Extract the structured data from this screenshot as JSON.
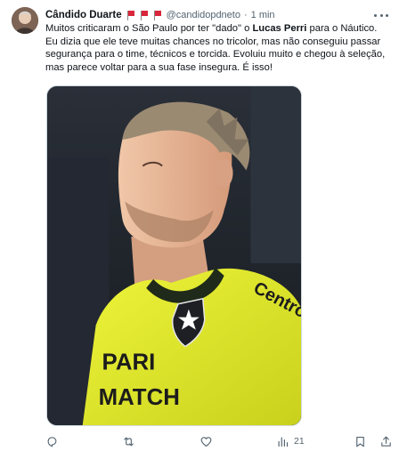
{
  "author": {
    "name": "Cândido Duarte",
    "handle": "@candidopdneto",
    "separator": "·",
    "time": "1 min",
    "flags": [
      "red-flag",
      "red-flag",
      "red-flag"
    ]
  },
  "tweet": {
    "text_segments": [
      "Muitos criticaram o São Paulo por ter \"dado\" o ",
      "Lucas Perri",
      " para o Náutico. Eu dizia que ele teve muitas chances no tricolor,  mas não conseguiu passar segurança para o time, técnicos e torcida. Evoluiu muito e chegou à seleção, mas parece voltar para a sua fase insegura. É isso!"
    ]
  },
  "media": {
    "jersey_text_1": "Centro",
    "jersey_text_2": "PARI",
    "jersey_text_3": "MATCH",
    "jersey_color": "#e6ef2a",
    "background_color": "#1b1f26"
  },
  "actions": {
    "reply_icon": "reply-icon",
    "retweet_icon": "retweet-icon",
    "like_icon": "heart-icon",
    "views_icon": "views-icon",
    "views_count": "21",
    "bookmark_icon": "bookmark-icon",
    "share_icon": "share-icon"
  }
}
